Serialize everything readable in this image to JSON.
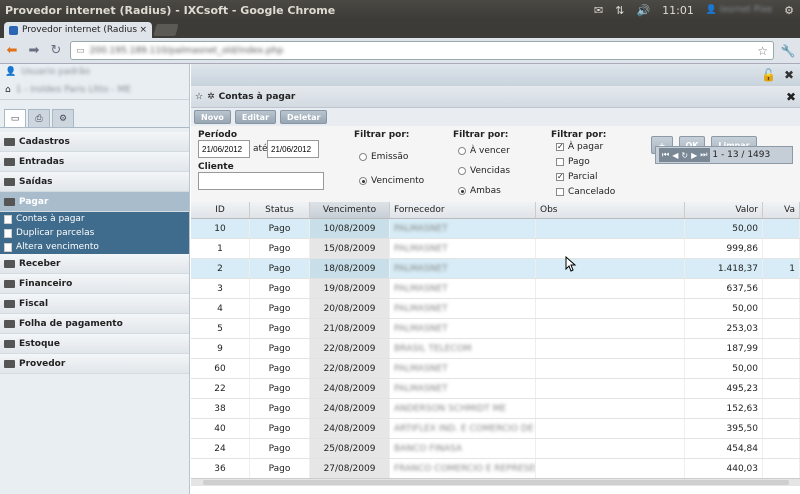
{
  "window": {
    "title": "Provedor internet (Radius) - IXCsoft - Google Chrome",
    "time": "11:01",
    "user": "Ixsrnet Pixe"
  },
  "browser": {
    "tab_title": "Provedor internet (Radius",
    "url": "200.195.189.110/palmasnet_old/index.php"
  },
  "sidebar": {
    "user": "Usuario padrão",
    "company": "1 - Iroldeo Paris Lltto - ME",
    "menu": [
      {
        "label": "Cadastros"
      },
      {
        "label": "Entradas"
      },
      {
        "label": "Saídas"
      },
      {
        "label": "Pagar"
      },
      {
        "label": "Receber"
      },
      {
        "label": "Financeiro"
      },
      {
        "label": "Fiscal"
      },
      {
        "label": "Folha de pagamento"
      },
      {
        "label": "Estoque"
      },
      {
        "label": "Provedor"
      }
    ],
    "submenu": [
      "Contas à pagar",
      "Duplicar parcelas",
      "Altera vencimento"
    ]
  },
  "panel": {
    "title": "Contas à pagar",
    "toolbar": {
      "novo": "Novo",
      "editar": "Editar",
      "deletar": "Deletar"
    },
    "periodo_label": "Período",
    "date_from": "21/06/2012",
    "ate_label": "até",
    "date_to": "21/06/2012",
    "cliente_label": "Cliente",
    "filtrar_label": "Filtrar por:",
    "filter1": [
      "Emissão",
      "Vencimento"
    ],
    "filter2": [
      "À vencer",
      "Vencidas",
      "Ambas"
    ],
    "filter3": [
      "À pagar",
      "Pago",
      "Parcial",
      "Cancelado"
    ],
    "btn_plus": "+",
    "btn_ok": "OK",
    "btn_limpar": "Limpar",
    "pager_text": "1 - 13 / 1493"
  },
  "table": {
    "columns": [
      "ID",
      "Status",
      "Vencimento",
      "Fornecedor",
      "Obs",
      "Valor",
      "Va"
    ],
    "rows": [
      {
        "id": "10",
        "status": "Pago",
        "venc": "10/08/2009",
        "forn": "PALMASNET",
        "valor": "50,00",
        "extra": ""
      },
      {
        "id": "1",
        "status": "Pago",
        "venc": "15/08/2009",
        "forn": "PALMASNET",
        "valor": "999,86",
        "extra": ""
      },
      {
        "id": "2",
        "status": "Pago",
        "venc": "18/08/2009",
        "forn": "PALMASNET",
        "valor": "1.418,37",
        "extra": "1"
      },
      {
        "id": "3",
        "status": "Pago",
        "venc": "19/08/2009",
        "forn": "PALMASNET",
        "valor": "637,56",
        "extra": ""
      },
      {
        "id": "4",
        "status": "Pago",
        "venc": "20/08/2009",
        "forn": "PALMASNET",
        "valor": "50,00",
        "extra": ""
      },
      {
        "id": "5",
        "status": "Pago",
        "venc": "21/08/2009",
        "forn": "PALMASNET",
        "valor": "253,03",
        "extra": ""
      },
      {
        "id": "9",
        "status": "Pago",
        "venc": "22/08/2009",
        "forn": "BRASIL TELECOM",
        "valor": "187,99",
        "extra": ""
      },
      {
        "id": "60",
        "status": "Pago",
        "venc": "22/08/2009",
        "forn": "PALMASNET",
        "valor": "50,00",
        "extra": ""
      },
      {
        "id": "22",
        "status": "Pago",
        "venc": "24/08/2009",
        "forn": "PALMASNET",
        "valor": "495,23",
        "extra": ""
      },
      {
        "id": "38",
        "status": "Pago",
        "venc": "24/08/2009",
        "forn": "ANDERSON SCHMIDT ME",
        "valor": "152,63",
        "extra": ""
      },
      {
        "id": "40",
        "status": "Pago",
        "venc": "24/08/2009",
        "forn": "ARTIFLEX IND. E COMERCIO DE C",
        "valor": "395,50",
        "extra": ""
      },
      {
        "id": "24",
        "status": "Pago",
        "venc": "25/08/2009",
        "forn": "BANCO FINASA",
        "valor": "454,84",
        "extra": ""
      },
      {
        "id": "36",
        "status": "Pago",
        "venc": "27/08/2009",
        "forn": "FRANCO COMERCIO E REPRESEN",
        "valor": "440,03",
        "extra": ""
      }
    ]
  }
}
